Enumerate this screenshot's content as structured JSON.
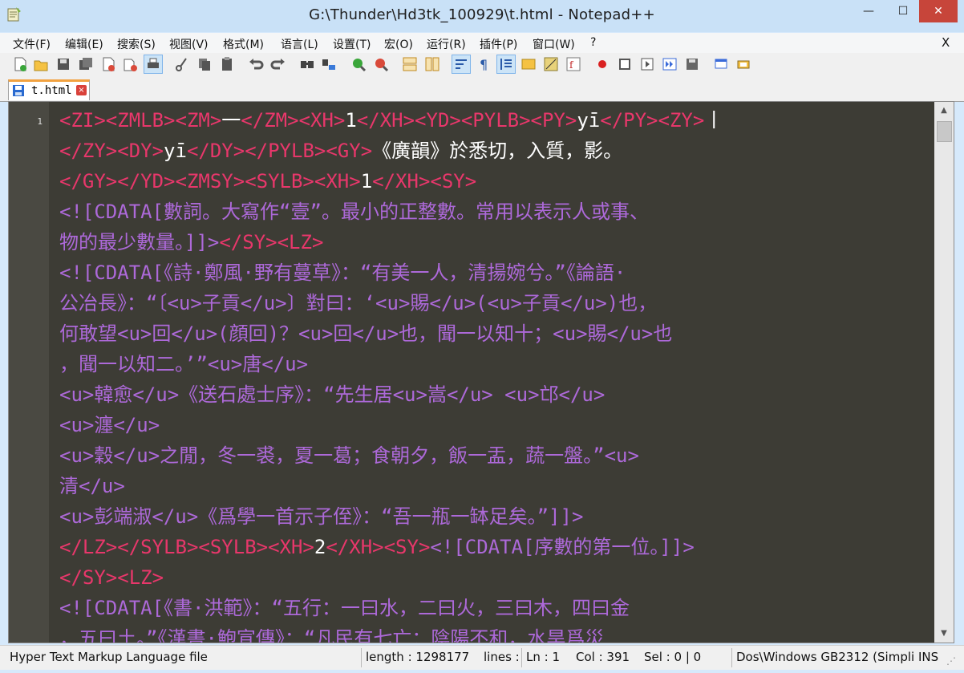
{
  "window": {
    "title": "G:\\Thunder\\Hd3tk_100929\\t.html - Notepad++",
    "minimize_glyph": "—",
    "maximize_glyph": "☐",
    "close_glyph": "✕"
  },
  "menubar": {
    "items": [
      "文件(F)",
      "编辑(E)",
      "搜索(S)",
      "视图(V)",
      "格式(M)",
      "语言(L)",
      "设置(T)",
      "宏(O)",
      "运行(R)",
      "插件(P)",
      "窗口(W)",
      "?"
    ],
    "close_label": "X"
  },
  "toolbar": {
    "icons": [
      "new-file-icon",
      "open-file-icon",
      "save-icon",
      "save-all-icon",
      "close-icon",
      "close-all-icon",
      "print-icon",
      "cut-icon",
      "copy-icon",
      "paste-icon",
      "undo-icon",
      "redo-icon",
      "find-icon",
      "replace-icon",
      "zoom-in-icon",
      "zoom-out-icon",
      "sync-vertical-icon",
      "sync-horizontal-icon",
      "word-wrap-icon",
      "show-all-characters-icon",
      "indent-guide-icon",
      "user-define-language-icon",
      "document-map-icon",
      "function-list-icon",
      "record-macro-icon",
      "stop-record-icon",
      "playback-macro-icon",
      "run-macro-multiple-icon",
      "save-macro-icon",
      "monitoring-icon",
      "panel-icon"
    ]
  },
  "tabs": [
    {
      "label": "t.html",
      "close_glyph": "×"
    }
  ],
  "editor": {
    "line_number": "1",
    "lines": [
      [
        [
          "tag",
          "<ZI><ZMLB><ZM>"
        ],
        [
          "txt",
          "一"
        ],
        [
          "tag",
          "</ZM><XH>"
        ],
        [
          "txt",
          "1"
        ],
        [
          "tag",
          "</XH><YD><PYLB><PY>"
        ],
        [
          "txt",
          "yī"
        ],
        [
          "tag",
          "</PY><ZY>"
        ],
        [
          "txt",
          "丨"
        ]
      ],
      [
        [
          "tag",
          "</ZY><DY>"
        ],
        [
          "txt",
          "yī"
        ],
        [
          "tag",
          "</DY></PYLB><GY>"
        ],
        [
          "txt",
          "《廣韻》於悉切，入質，影。"
        ]
      ],
      [
        [
          "tag",
          "</GY></YD><ZMSY><SYLB><XH>"
        ],
        [
          "txt",
          "1"
        ],
        [
          "tag",
          "</XH><SY>"
        ]
      ],
      [
        [
          "cd",
          "<![CDATA[數詞。大寫作“壹”。最小的正整數。常用以表示人或事、"
        ]
      ],
      [
        [
          "cd",
          "物的最少數量。]]>"
        ],
        [
          "tag",
          "</SY><LZ>"
        ]
      ],
      [
        [
          "cd",
          "<![CDATA[《詩·鄭風·野有蔓草》：“有美一人，清揚婉兮。”《論語·"
        ]
      ],
      [
        [
          "cd",
          "公冶長》：“〔<u>子貢</u>〕對曰：‘<u>賜</u>(<u>子貢</u>)也，"
        ]
      ],
      [
        [
          "cd",
          "何敢望<u>回</u>(顔回)？<u>回</u>也，聞一以知十；<u>賜</u>也"
        ]
      ],
      [
        [
          "cd",
          "，聞一以知二。’”<u>唐</u>"
        ]
      ],
      [
        [
          "cd",
          "<u>韓愈</u>《送石處士序》：“先生居<u>嵩</u> <u>邙</u>"
        ]
      ],
      [
        [
          "cd",
          "<u>瀍</u>"
        ]
      ],
      [
        [
          "cd",
          "<u>穀</u>之閒，冬一裘，夏一葛；食朝夕，飯一盂，蔬一盤。”<u>"
        ]
      ],
      [
        [
          "cd",
          "清</u>"
        ]
      ],
      [
        [
          "cd",
          "<u>彭端淑</u>《爲學一首示子侄》：“吾一瓶一缽足矣。”]]>"
        ]
      ],
      [
        [
          "tag",
          "</LZ></SYLB><SYLB><XH>"
        ],
        [
          "txt",
          "2"
        ],
        [
          "tag",
          "</XH><SY>"
        ],
        [
          "cd",
          "<![CDATA[序數的第一位。]]>"
        ]
      ],
      [
        [
          "tag",
          "</SY><LZ>"
        ]
      ],
      [
        [
          "cd",
          "<![CDATA[《書·洪範》：“五行：一曰水，二曰火，三曰木，四曰金"
        ]
      ],
      [
        [
          "cd",
          "，五曰土。”《漢書·鮑宣傳》：“凡民有七亡：陰陽不和，水旱爲災"
        ]
      ]
    ]
  },
  "statusbar": {
    "file_type": "Hyper Text Markup Language file",
    "length": "length : 1298177",
    "lines": "lines :",
    "ln": "Ln : 1",
    "col": "Col : 391",
    "sel": "Sel : 0 | 0",
    "encoding": "Dos\\Windows GB2312 (Simpli INS"
  },
  "colors": {
    "editor_bg": "#3d3c35",
    "tag": "#e8376b",
    "text": "#ffffff",
    "cdata": "#ad69d9"
  }
}
